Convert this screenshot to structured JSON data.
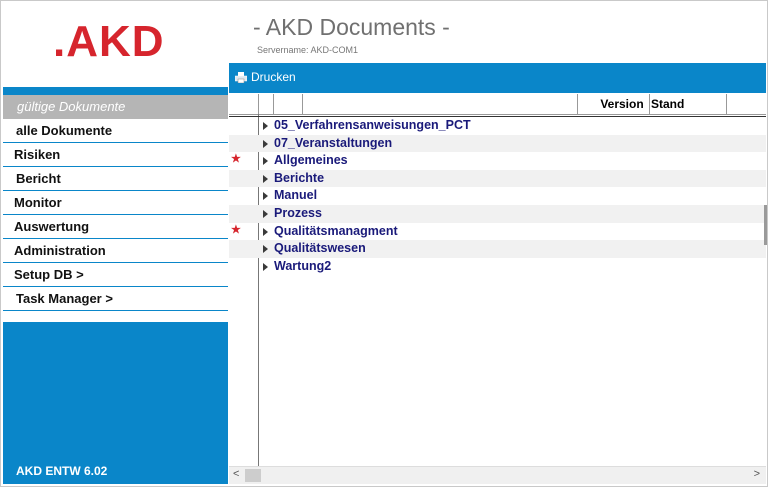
{
  "logo": {
    "text": ".AKD"
  },
  "header": {
    "title": "- AKD Documents -",
    "server": "Servername: AKD-COM1"
  },
  "toolbar": {
    "print_label": "Drucken"
  },
  "sidebar": {
    "heading": "gültige Dokumente",
    "items": [
      {
        "label": "alle Dokumente"
      },
      {
        "label": "Risiken"
      },
      {
        "label": "Bericht"
      },
      {
        "label": "Monitor"
      },
      {
        "label": "Auswertung"
      },
      {
        "label": "Administration"
      },
      {
        "label": "Setup DB >"
      },
      {
        "label": "Task Manager >"
      }
    ],
    "version": "AKD ENTW 6.02"
  },
  "grid": {
    "columns": {
      "version": "Version",
      "stand": "Stand"
    },
    "rows": [
      {
        "label": "05_Verfahrensanweisungen_PCT",
        "starred": false
      },
      {
        "label": "07_Veranstaltungen",
        "starred": false
      },
      {
        "label": "Allgemeines",
        "starred": true
      },
      {
        "label": "Berichte",
        "starred": false
      },
      {
        "label": "Manuel",
        "starred": false
      },
      {
        "label": "Prozess",
        "starred": false
      },
      {
        "label": "Qualitätsmanagment",
        "starred": true
      },
      {
        "label": "Qualitätswesen",
        "starred": false
      },
      {
        "label": "Wartung2",
        "starred": false
      }
    ]
  },
  "scrollbar": {
    "left": "<",
    "right": ">"
  },
  "colors": {
    "accent": "#0a86c9",
    "brand_red": "#d6252d",
    "star": "#d6252d"
  }
}
